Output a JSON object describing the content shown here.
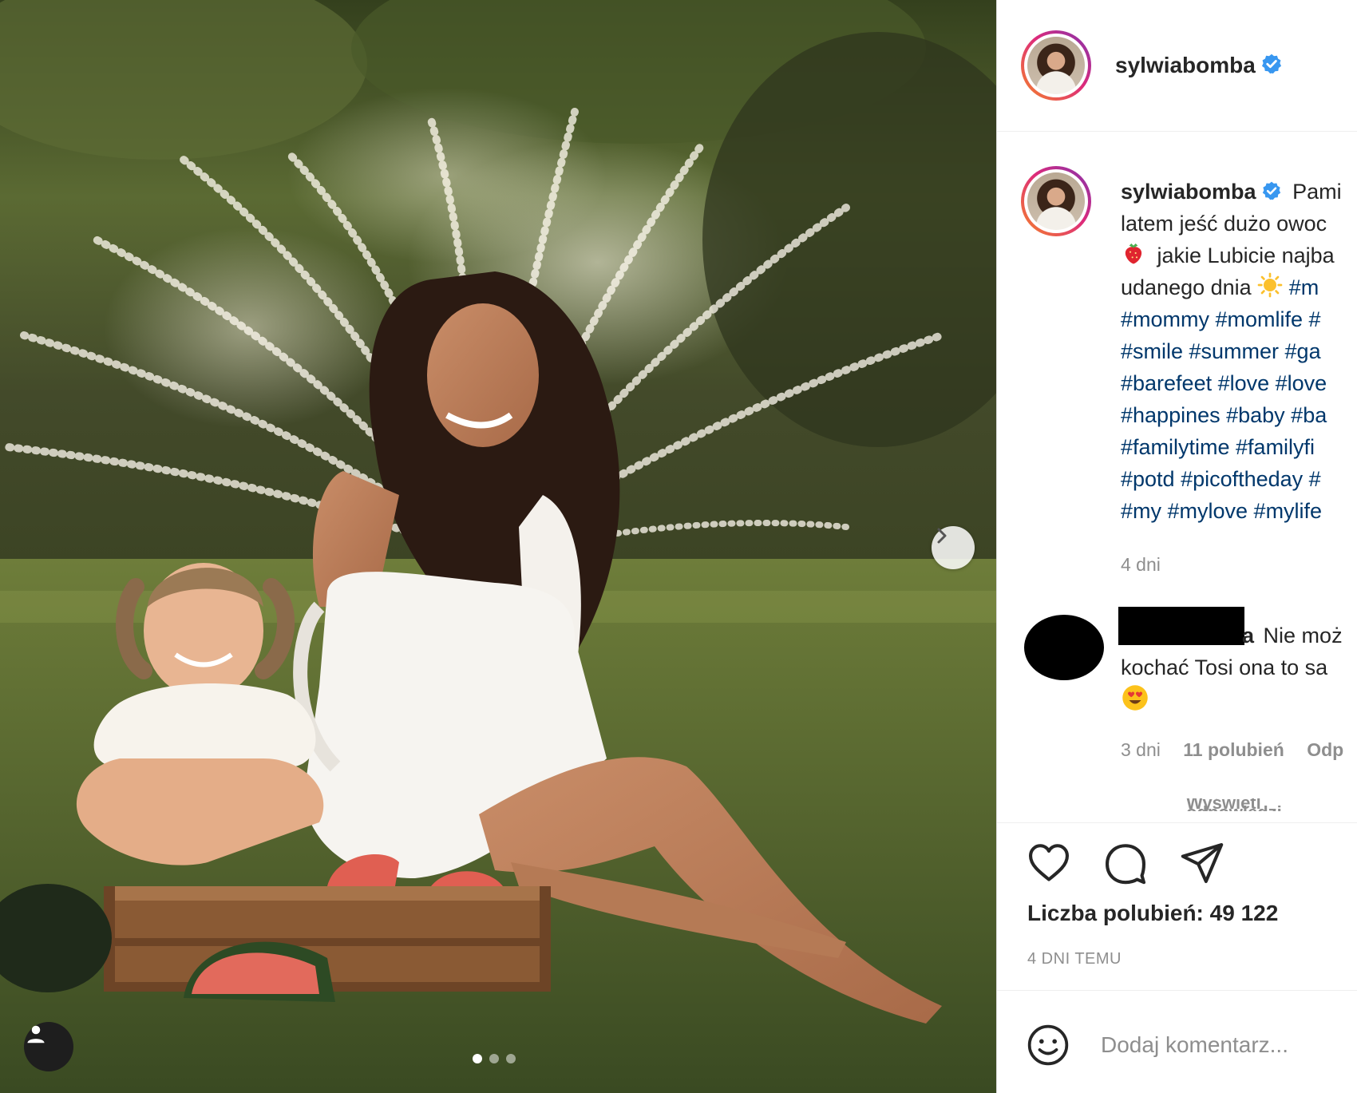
{
  "post": {
    "username": "sylwiabomba",
    "verified_icon": "verified-badge-icon",
    "carousel": {
      "total_slides": 3,
      "active_slide": 1
    }
  },
  "caption": {
    "username": "sylwiabomba",
    "lines": [
      "Pami",
      "latem jeść dużo owoc",
      "jakie Lubicie najba",
      "udanego dnia"
    ],
    "inline_tag": "#m",
    "hashtag_lines": [
      "#mommy #momlife #",
      "#smile #summer #ga",
      "#barefeet #love #love",
      "#happines #baby #ba",
      "#familytime #familyfi",
      "#potd #picoftheday #",
      "#my #mylove #mylife"
    ],
    "time": "4 dni"
  },
  "comment": {
    "username_visible": "a",
    "text_line1": "Nie moż",
    "text_line2": "kochać Tosi ona to sa",
    "time": "3 dni",
    "likes": "11 polubień",
    "reply": "Odp",
    "view_replies": "Wyświetl odpowiedzi"
  },
  "stats": {
    "likes_label": "Liczba polubień: 49 122",
    "date": "4 DNI TEMU"
  },
  "add_comment": {
    "placeholder": "Dodaj komentarz..."
  },
  "colors": {
    "hashtag": "#00376b",
    "verified": "#3897f0",
    "muted": "#8e8e8e",
    "text": "#262626"
  }
}
